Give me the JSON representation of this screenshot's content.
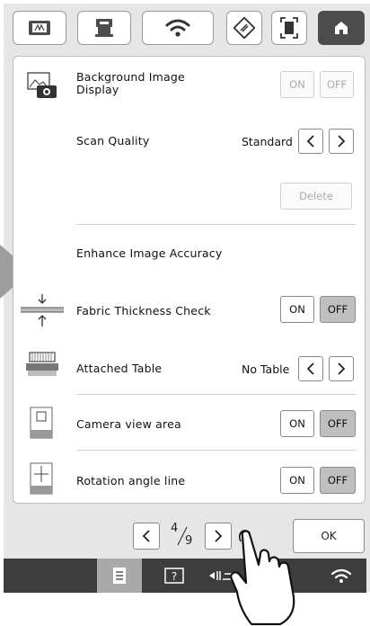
{
  "tabs": [
    {
      "id": "embroidery-settings",
      "icon": "embroidery-frame-icon"
    },
    {
      "id": "machine",
      "icon": "machine-icon"
    },
    {
      "id": "wireless",
      "icon": "wifi-icon"
    },
    {
      "id": "eco",
      "icon": "eco-icon"
    },
    {
      "id": "screen",
      "icon": "screen-icon"
    },
    {
      "id": "home",
      "icon": "home-icon",
      "active": true
    }
  ],
  "settings": {
    "background_image": {
      "label": "Background Image\nDisplay",
      "on": "ON",
      "off": "OFF"
    },
    "scan_quality": {
      "label": "Scan Quality",
      "value": "Standard"
    },
    "delete": {
      "label": "Delete"
    },
    "enhance": {
      "label": "Enhance Image Accuracy"
    },
    "fabric_thickness": {
      "label": "Fabric Thickness Check",
      "on": "ON",
      "off": "OFF",
      "selected": "OFF"
    },
    "attached_table": {
      "label": "Attached Table",
      "value": "No Table"
    },
    "camera_view": {
      "label": "Camera view area",
      "on": "ON",
      "off": "OFF",
      "selected": "OFF"
    },
    "rotation_line": {
      "label": "Rotation angle line",
      "on": "ON",
      "off": "OFF",
      "selected": "OFF"
    }
  },
  "pager": {
    "current": "4",
    "total": "9"
  },
  "ok": "OK",
  "statusbar": [
    {
      "icon": "settings-page-icon",
      "active": true
    },
    {
      "icon": "help-icon"
    },
    {
      "icon": "presser-foot-icon"
    },
    {
      "icon": "wifi-status-icon"
    }
  ]
}
